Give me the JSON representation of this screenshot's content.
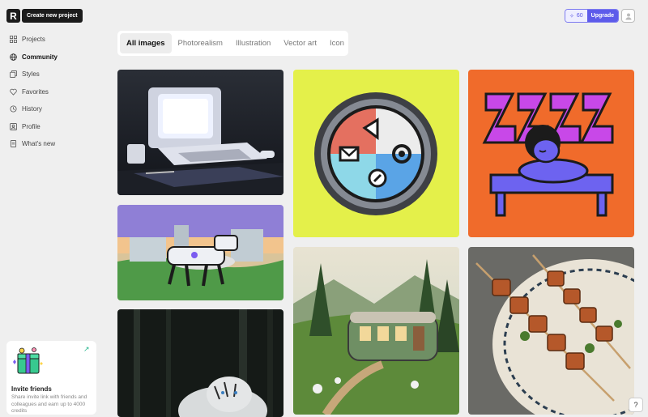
{
  "app": {
    "create_label": "Create new project"
  },
  "sidebar": {
    "items": [
      {
        "label": "Projects",
        "icon": "grid-icon",
        "active": false
      },
      {
        "label": "Community",
        "icon": "globe-icon",
        "active": true
      },
      {
        "label": "Styles",
        "icon": "styles-icon",
        "active": false
      },
      {
        "label": "Favorites",
        "icon": "heart-icon",
        "active": false
      },
      {
        "label": "History",
        "icon": "history-icon",
        "active": false
      },
      {
        "label": "Profile",
        "icon": "profile-icon",
        "active": false
      },
      {
        "label": "What's new",
        "icon": "news-icon",
        "active": false
      }
    ]
  },
  "invite": {
    "title": "Invite friends",
    "text": "Share invite link with friends and colleagues and earn up to 4000 credits"
  },
  "header": {
    "credits": "60",
    "upgrade_label": "Upgrade"
  },
  "tabs": [
    {
      "label": "All images",
      "active": true
    },
    {
      "label": "Photorealism",
      "active": false
    },
    {
      "label": "Illustration",
      "active": false
    },
    {
      "label": "Vector art",
      "active": false
    },
    {
      "label": "Icon",
      "active": false
    }
  ],
  "gallery": [
    {
      "name": "retro-computer-image"
    },
    {
      "name": "round-badge-icons-image"
    },
    {
      "name": "sleeping-person-zzz-image"
    },
    {
      "name": "robot-dog-factory-image"
    },
    {
      "name": "tram-house-valley-image"
    },
    {
      "name": "kebab-skewers-image"
    },
    {
      "name": "white-tiger-forest-image"
    }
  ],
  "colors": {
    "accent": "#5d5bea",
    "dark": "#1b1b1b",
    "background": "#efefef"
  }
}
